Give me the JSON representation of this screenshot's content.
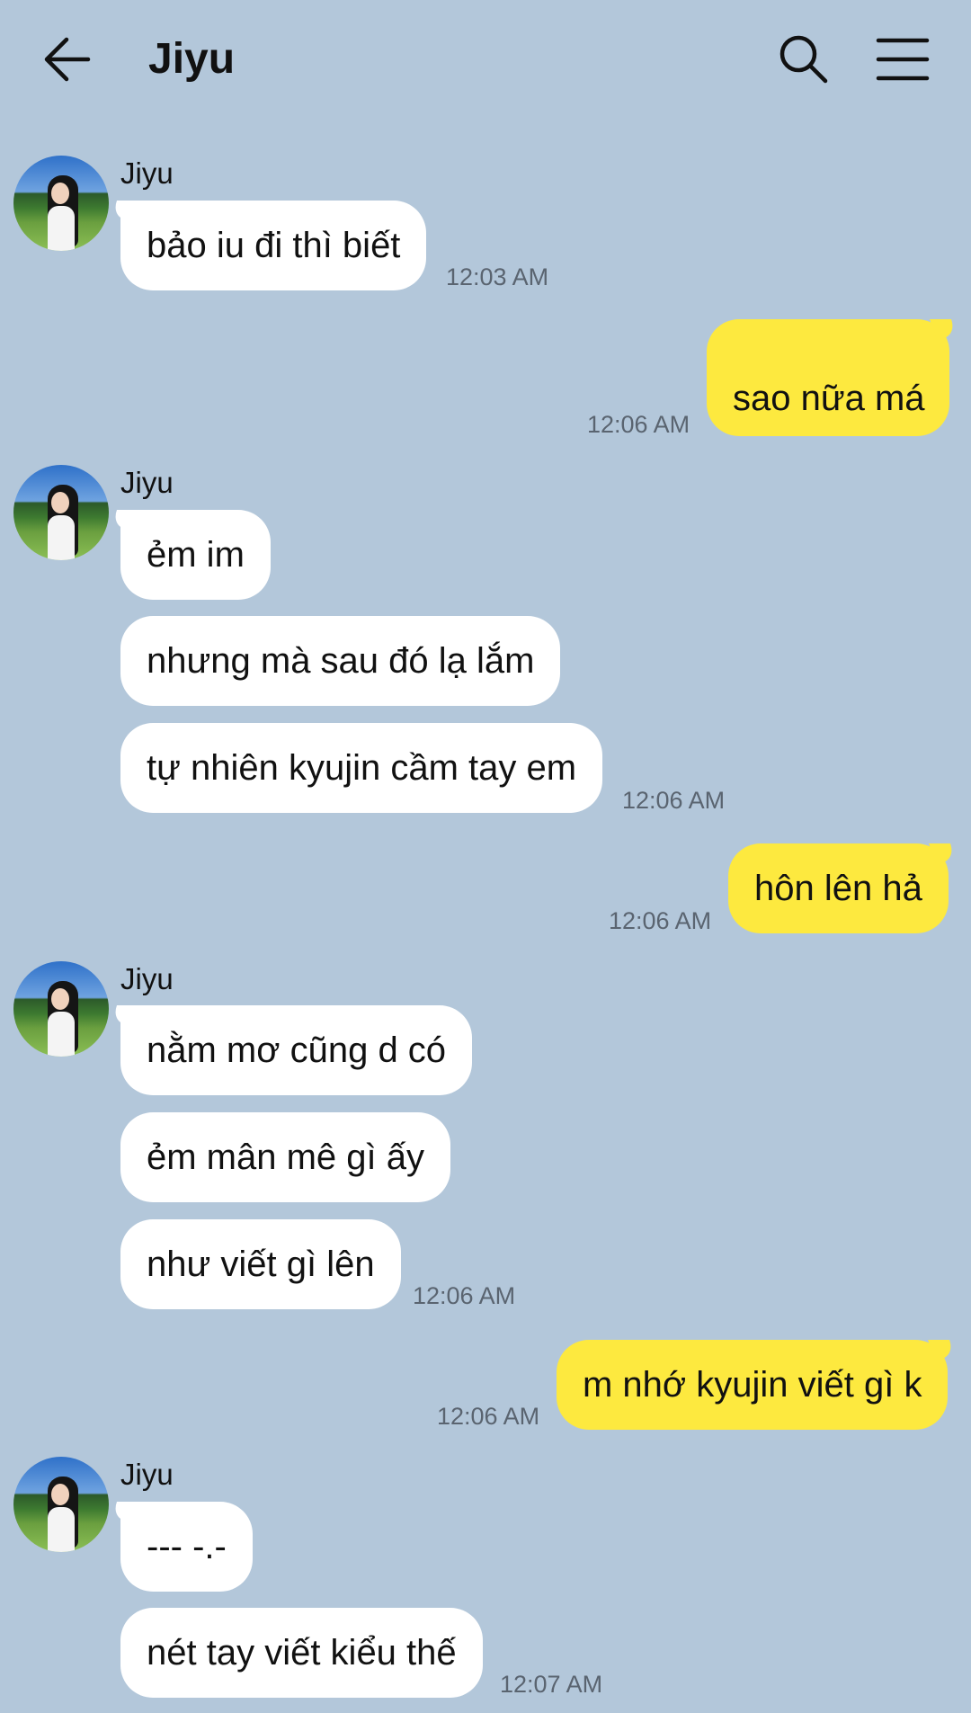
{
  "header": {
    "title": "Jiyu",
    "back_icon": "arrow-left-icon",
    "search_icon": "search-icon",
    "menu_icon": "hamburger-menu-icon"
  },
  "colors": {
    "background": "#b3c7da",
    "incoming_bubble": "#ffffff",
    "outgoing_bubble": "#fde93f"
  },
  "messages": [
    {
      "sender": "Jiyu",
      "text": "bảo iu đi thì biết",
      "time": "12:03 AM",
      "direction": "incoming"
    },
    {
      "text": "sao nữa má",
      "time": "12:06 AM",
      "direction": "outgoing"
    },
    {
      "sender": "Jiyu",
      "text": "ẻm im",
      "direction": "incoming"
    },
    {
      "text": "nhưng mà sau đó lạ lắm",
      "direction": "incoming"
    },
    {
      "text": "tự nhiên kyujin cầm tay em",
      "time": "12:06 AM",
      "direction": "incoming"
    },
    {
      "text": "hôn lên hả",
      "time": "12:06 AM",
      "direction": "outgoing"
    },
    {
      "sender": "Jiyu",
      "text": "nằm mơ cũng d có",
      "direction": "incoming"
    },
    {
      "text": "ẻm mân mê gì ấy",
      "direction": "incoming"
    },
    {
      "text": "như viết gì lên",
      "time": "12:06 AM",
      "direction": "incoming"
    },
    {
      "text": "m nhớ kyujin viết gì k",
      "time": "12:06 AM",
      "direction": "outgoing"
    },
    {
      "sender": "Jiyu",
      "text": "--- -.-",
      "direction": "incoming"
    },
    {
      "text": "nét tay viết kiểu thế",
      "time": "12:07 AM",
      "direction": "incoming"
    }
  ]
}
